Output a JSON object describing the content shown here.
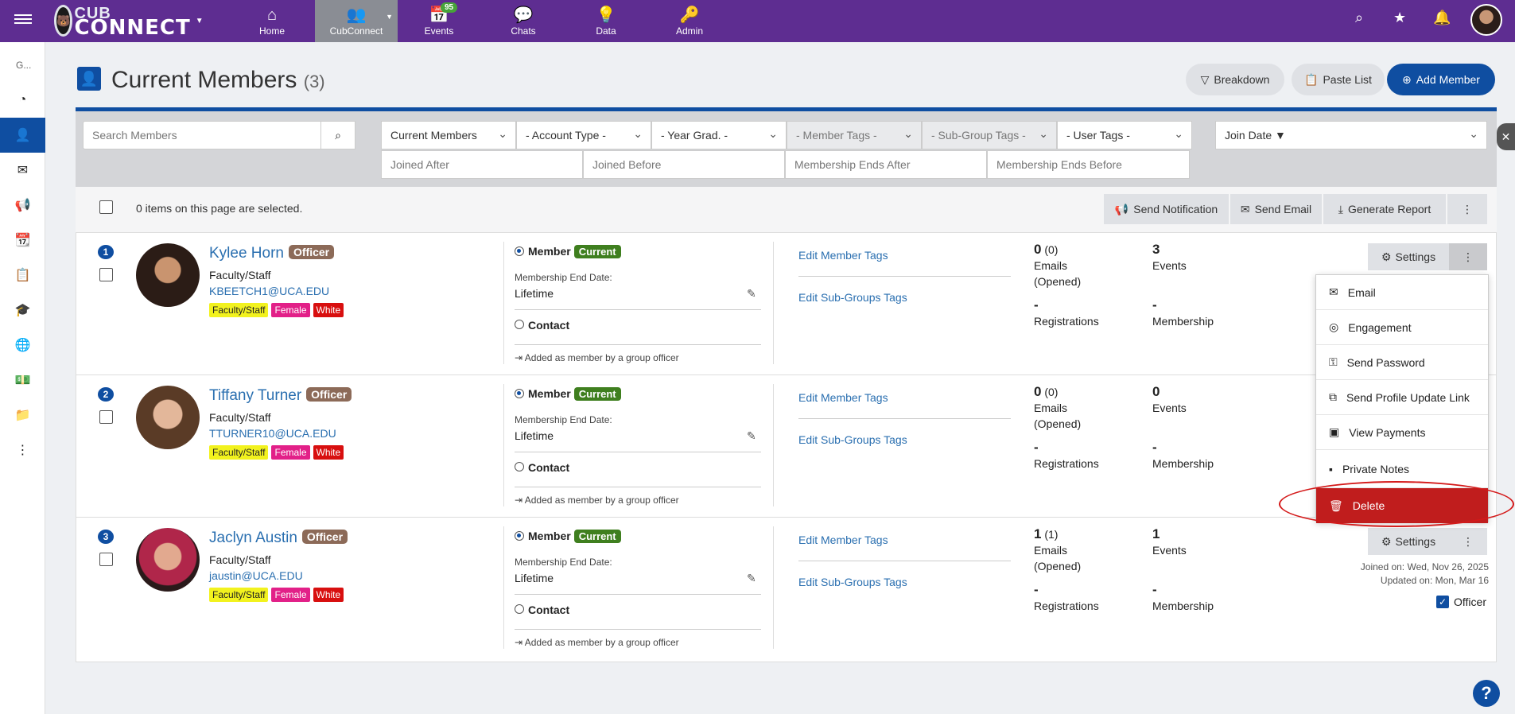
{
  "topbar": {
    "logo_text_top": "CUB",
    "logo_text_bottom": "CONNECT",
    "nav": [
      {
        "label": "Home",
        "icon": "home-icon"
      },
      {
        "label": "CubConnect",
        "icon": "people-icon"
      },
      {
        "label": "Events",
        "icon": "calendar-icon",
        "badge": "95"
      },
      {
        "label": "Chats",
        "icon": "chat-icon"
      },
      {
        "label": "Data",
        "icon": "lightbulb-icon"
      },
      {
        "label": "Admin",
        "icon": "key-icon"
      }
    ]
  },
  "rail": {
    "group_label": "G..."
  },
  "page": {
    "title": "Current Members",
    "count": "(3)",
    "breakdown_label": "Breakdown",
    "paste_list_label": "Paste List",
    "add_member_label": "Add Member"
  },
  "filters": {
    "search_placeholder": "Search Members",
    "status": "Current Members",
    "account_type": "- Account Type -",
    "year_grad": "- Year Grad. -",
    "member_tags": "- Member Tags -",
    "subgroup_tags": "- Sub-Group Tags -",
    "user_tags": "- User Tags -",
    "sort": "Join Date ▼",
    "joined_after": "Joined After",
    "joined_before": "Joined Before",
    "membership_ends_after": "Membership Ends After",
    "membership_ends_before": "Membership Ends Before"
  },
  "selection": {
    "text": "0 items on this page are selected.",
    "send_notification": "Send Notification",
    "send_email": "Send Email",
    "generate_report": "Generate Report"
  },
  "labels": {
    "officer": "Officer",
    "member": "Member",
    "current": "Current",
    "membership_end_date": "Membership End Date:",
    "lifetime": "Lifetime",
    "contact": "Contact",
    "added_by": "Added as member by a group officer",
    "edit_member_tags": "Edit Member Tags",
    "edit_subgroup_tags": "Edit Sub-Groups Tags",
    "emails": "Emails",
    "opened": "(Opened)",
    "events": "Events",
    "registrations": "Registrations",
    "membership": "Membership",
    "dash": "-",
    "settings": "Settings",
    "officer_check": "Officer"
  },
  "members": [
    {
      "index": "1",
      "name": "Kylee Horn",
      "role": "Faculty/Staff",
      "email": "KBEETCH1@UCA.EDU",
      "tags": [
        "Faculty/Staff",
        "Female",
        "White"
      ],
      "emails": "0",
      "emails_opened": "(0)",
      "events": "3"
    },
    {
      "index": "2",
      "name": "Tiffany Turner",
      "role": "Faculty/Staff",
      "email": "TTURNER10@UCA.EDU",
      "tags": [
        "Faculty/Staff",
        "Female",
        "White"
      ],
      "emails": "0",
      "emails_opened": "(0)",
      "events": "0"
    },
    {
      "index": "3",
      "name": "Jaclyn Austin",
      "role": "Faculty/Staff",
      "email": "jaustin@UCA.EDU",
      "tags": [
        "Faculty/Staff",
        "Female",
        "White"
      ],
      "emails": "1",
      "emails_opened": "(1)",
      "events": "1",
      "joined_on": "Joined on: Wed, Nov 26, 2025",
      "updated_on": "Updated on: Mon, Mar 16"
    }
  ],
  "dropdown": {
    "items": [
      "Email",
      "Engagement",
      "Send Password",
      "Send Profile Update Link",
      "View Payments",
      "Private Notes"
    ],
    "delete": "Delete"
  }
}
